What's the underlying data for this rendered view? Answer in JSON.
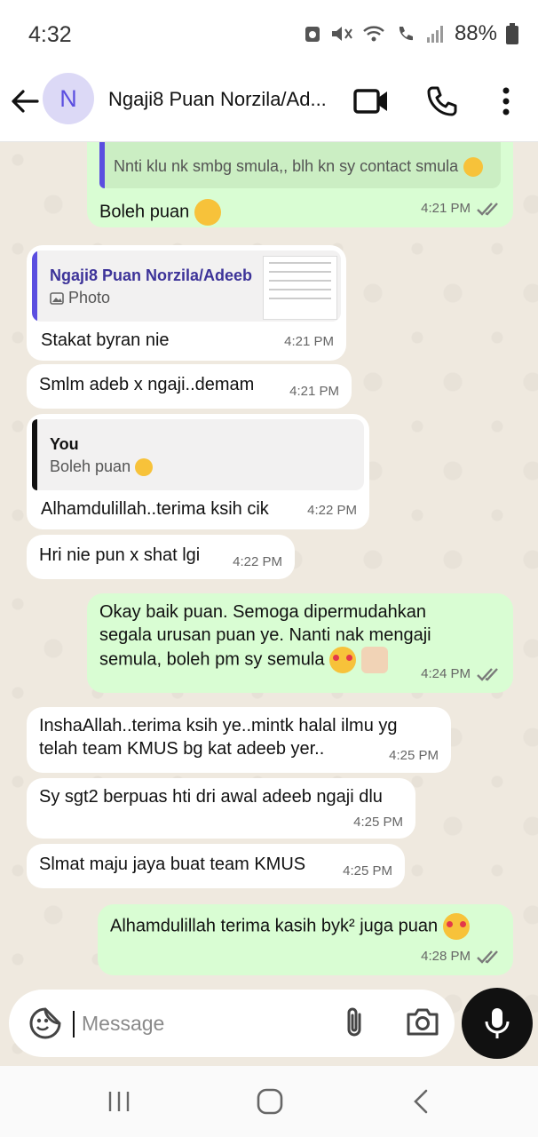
{
  "status": {
    "time": "4:32",
    "battery": "88%"
  },
  "header": {
    "avatar_letter": "N",
    "title": "Ngaji8 Puan Norzila/Ad..."
  },
  "messages": {
    "m1": {
      "quote_text": "Nnti klu nk smbg smula,, blh kn sy contact smula",
      "text": "Boleh puan",
      "time": "4:21 PM"
    },
    "m2": {
      "reply_name": "Ngaji8 Puan Norzila/Adeeb",
      "reply_type": "Photo",
      "text": "Stakat byran nie",
      "time": "4:21 PM"
    },
    "m3": {
      "text": "Smlm adeb x ngaji..demam",
      "time": "4:21 PM"
    },
    "m4": {
      "reply_name": "You",
      "reply_text": "Boleh puan",
      "text": "Alhamdulillah..terima ksih cik",
      "time": "4:22 PM"
    },
    "m5": {
      "text": "Hri nie pun x shat lgi",
      "time": "4:22 PM"
    },
    "m6": {
      "line1": "Okay baik puan. Semoga dipermudahkan",
      "line2": "segala urusan puan ye. Nanti nak mengaji",
      "line3": "semula, boleh pm sy semula",
      "time": "4:24 PM"
    },
    "m7": {
      "line1": "InshaAllah..terima ksih ye..mintk halal ilmu yg",
      "line2": "telah team KMUS bg kat adeeb yer..",
      "time": "4:25 PM"
    },
    "m8": {
      "text": "Sy sgt2 berpuas hti dri awal adeeb ngaji dlu",
      "time": "4:25 PM"
    },
    "m9": {
      "text": "Slmat maju jaya buat team KMUS",
      "time": "4:25 PM"
    },
    "m10": {
      "text": "Alhamdulillah terima kasih byk² juga puan",
      "time": "4:28 PM"
    }
  },
  "input": {
    "placeholder": "Message"
  },
  "colors": {
    "outgoing": "#d9fdd3",
    "incoming": "#ffffff",
    "accent": "#5b4ee0",
    "tick": "#7a7a7a"
  },
  "icons": [
    "back-arrow-icon",
    "video-call-icon",
    "phone-icon",
    "more-options-icon",
    "sticker-icon",
    "attach-icon",
    "camera-icon",
    "mic-icon",
    "recents-icon",
    "home-icon",
    "nav-back-icon",
    "double-check-icon",
    "photo-icon",
    "smile-emoji-icon",
    "heart-eyes-emoji-icon",
    "thumbs-up-emoji-icon"
  ]
}
